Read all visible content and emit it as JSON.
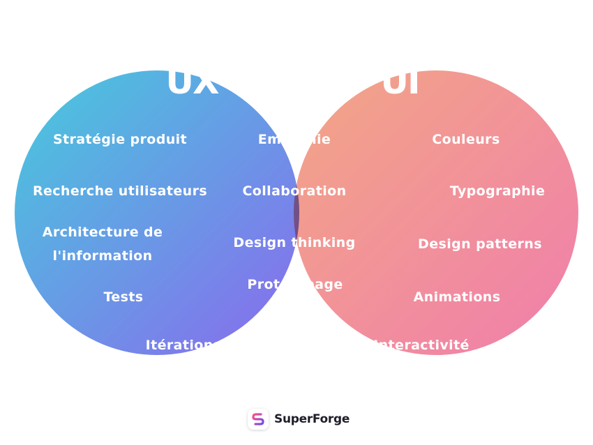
{
  "titles": {
    "left": "UX",
    "right": "UI"
  },
  "left_items": [
    "Stratégie produit",
    "Recherche utilisateurs",
    "Architecture de\nl'information",
    "Tests",
    "Itérations"
  ],
  "center_items": [
    "Empathie",
    "Collaboration",
    "Design thinking",
    "Prototypage"
  ],
  "right_items": [
    "Couleurs",
    "Typographie",
    "Design patterns",
    "Animations",
    "Interactivité"
  ],
  "brand": {
    "name": "SuperForge",
    "icon": "superforge-logo-icon"
  },
  "colors": {
    "ux_gradient_start": "#22b8d8",
    "ux_gradient_end": "#6c4ee8",
    "ui_gradient_start": "#f2a48a",
    "ui_gradient_end": "#f080aa",
    "text": "#ffffff",
    "brand_text": "#1e1e2a"
  }
}
